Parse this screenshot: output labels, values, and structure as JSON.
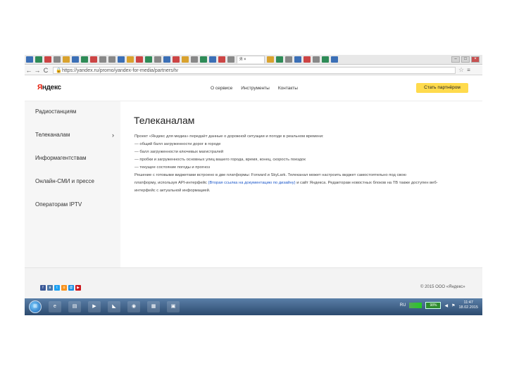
{
  "browser": {
    "active_tab_label": "Я ×",
    "url": "https://yandex.ru/promo/yandex-for-media/partners/tv",
    "back_icon": "arrow-left-icon",
    "forward_icon": "arrow-right-icon",
    "reload_icon": "reload-icon",
    "tab_colors": [
      "#3b6fb6",
      "#2e8b57",
      "#c44",
      "#888",
      "#d9a22e",
      "#3b6fb6",
      "#2e8b57",
      "#c44",
      "#888",
      "#888",
      "#3b6fb6",
      "#d9a22e",
      "#c44",
      "#2e8b57",
      "#888",
      "#3b6fb6",
      "#c44",
      "#d9a22e",
      "#888",
      "#2e8b57",
      "#3b6fb6",
      "#c44",
      "#888",
      "#d9a22e",
      "#2e8b57",
      "#888",
      "#3b6fb6",
      "#c44",
      "#888",
      "#2e8b57",
      "#3b6fb6"
    ]
  },
  "header": {
    "logo_y": "Я",
    "logo_rest": "ндекс",
    "nav": [
      "О сервисе",
      "Инструменты",
      "Контакты"
    ],
    "partner_button": "Стать партнёром"
  },
  "sidebar": {
    "items": [
      {
        "label": "Радиостанциям"
      },
      {
        "label": "Телеканалам",
        "active": true
      },
      {
        "label": "Информагентствам"
      },
      {
        "label": "Онлайн-СМИ и прессе"
      },
      {
        "label": "Операторам IPTV"
      }
    ],
    "chevron": "›"
  },
  "main": {
    "title": "Телеканалам",
    "lines": [
      "Проект «Яндекс для медиа» передаёт данные о дорожной ситуации и погоде в реальном времени:",
      "— общий балл загруженности дорог в городе",
      "— балл загруженности ключевых магистралей",
      "— пробки и загруженность основных улиц вашего города, время, конец, скорость поездок",
      "— текущее состояние погоды и прогноз",
      "Решение с готовыми виджетами встроено в две платформы: Forward и SkyLark. Телеканал может настроить виджет самостоятельно под свою",
      "платформу, используя API-интерфейс",
      "и сайт Яндекса. Редакторам новостных блоков на ТВ также доступен веб-",
      "интерфейс с актуальной информацией."
    ],
    "link_text": "(Вторая ссылка на документацию по дизайну)"
  },
  "footer": {
    "social": [
      {
        "icon": "facebook-icon",
        "glyph": "f",
        "color": "#3b5998"
      },
      {
        "icon": "vk-icon",
        "glyph": "в",
        "color": "#4a76a8"
      },
      {
        "icon": "twitter-icon",
        "glyph": "t",
        "color": "#1da1f2"
      },
      {
        "icon": "odnoklassniki-icon",
        "glyph": "о",
        "color": "#f7931e"
      },
      {
        "icon": "mail-icon",
        "glyph": "@",
        "color": "#168de2"
      },
      {
        "icon": "youtube-icon",
        "glyph": "▶",
        "color": "#cc181e"
      }
    ],
    "copyright": "© 2015 ООО «Яндекс»"
  },
  "taskbar": {
    "start_icon": "windows-start-icon",
    "apps": [
      {
        "icon": "ie-icon",
        "glyph": "e"
      },
      {
        "icon": "folder-icon",
        "glyph": "▤"
      },
      {
        "icon": "media-player-icon",
        "glyph": "▶"
      },
      {
        "icon": "bird-app-icon",
        "glyph": "◣"
      },
      {
        "icon": "chrome-icon",
        "glyph": "◉"
      },
      {
        "icon": "network-app-icon",
        "glyph": "▦"
      },
      {
        "icon": "paint-icon",
        "glyph": "▣"
      }
    ],
    "lang": "RU",
    "battery": "98%",
    "time": "11:47",
    "date": "18.02.2015"
  }
}
